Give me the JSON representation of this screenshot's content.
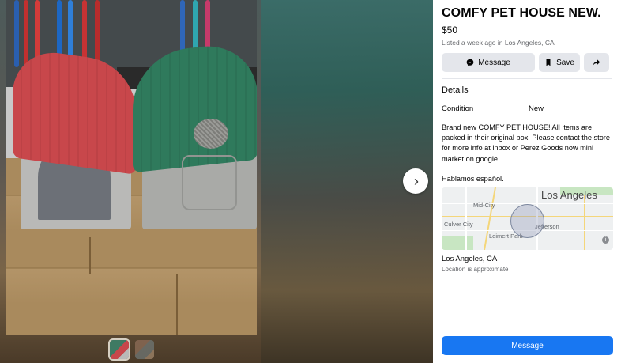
{
  "listing": {
    "title": "COMFY PET HOUSE NEW.",
    "price": "$50",
    "meta": "Listed a week ago in Los Angeles, CA"
  },
  "actions": {
    "message_label": "Message",
    "save_label": "Save",
    "share_icon": "share-arrow-icon"
  },
  "details": {
    "heading": "Details",
    "condition_label": "Condition",
    "condition_value": "New",
    "description": "Brand new COMFY PET HOUSE! All items are packed in their original box. Please contact the store for more info at inbox or Perez Goods now mini market  on google.",
    "language_note": "Hablamos español."
  },
  "map": {
    "city_label": "Los Angeles",
    "neighborhoods": [
      "Mid-City",
      "Culver City",
      "Leimert Park",
      "Jefferson"
    ]
  },
  "location": {
    "name": "Los Angeles, CA",
    "note": "Location is approximate"
  },
  "cta": {
    "label": "Message"
  },
  "colors": {
    "accent": "#1877f2",
    "button_bg": "#e4e6eb",
    "secondary_text": "#65676b"
  }
}
